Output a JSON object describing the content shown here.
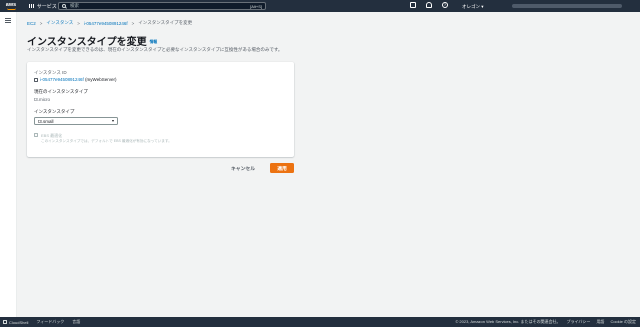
{
  "nav": {
    "services_label": "サービス",
    "search_placeholder": "検索",
    "search_shortcut": "[Alt+S]",
    "region_label": "オレゴン ▾"
  },
  "breadcrumb": {
    "items": [
      "EC2",
      "インスタンス",
      "i-05477e9450891246f"
    ],
    "current": "インスタンスタイプを変更"
  },
  "page": {
    "title": "インスタンスタイプを変更",
    "info_label": "情報",
    "description": "インスタンスタイプを変更できるのは、現在のインスタンスタイプと必要なインスタンスタイプに互換性がある場合のみです。"
  },
  "form": {
    "instance_id_label": "インスタンス ID",
    "instance_id": "i-05477e9450891246f",
    "instance_name": "(myWebServer)",
    "current_type_label": "現在のインスタンスタイプ",
    "current_type": "t3.micro",
    "type_label": "インスタンスタイプ",
    "type_selected": "t3.small",
    "ebs_checkbox_label": "EBS 最適化",
    "ebs_help": "このインスタンスタイプでは、デフォルトで EBS 最適化が有効になっています。"
  },
  "actions": {
    "cancel_label": "キャンセル",
    "apply_label": "適用"
  },
  "footer": {
    "cloudshell_label": "CloudShell",
    "feedback_label": "フィードバック",
    "language_label": "言語",
    "copyright": "© 2023, Amazon Web Services, Inc. またはその関連会社。",
    "privacy_label": "プライバシー",
    "terms_label": "用語",
    "cookie_label": "Cookie の設定"
  },
  "colors": {
    "nav_bg": "#232f3e",
    "link": "#0073bb",
    "primary_button": "#ec7211",
    "page_bg": "#f2f3f3"
  }
}
